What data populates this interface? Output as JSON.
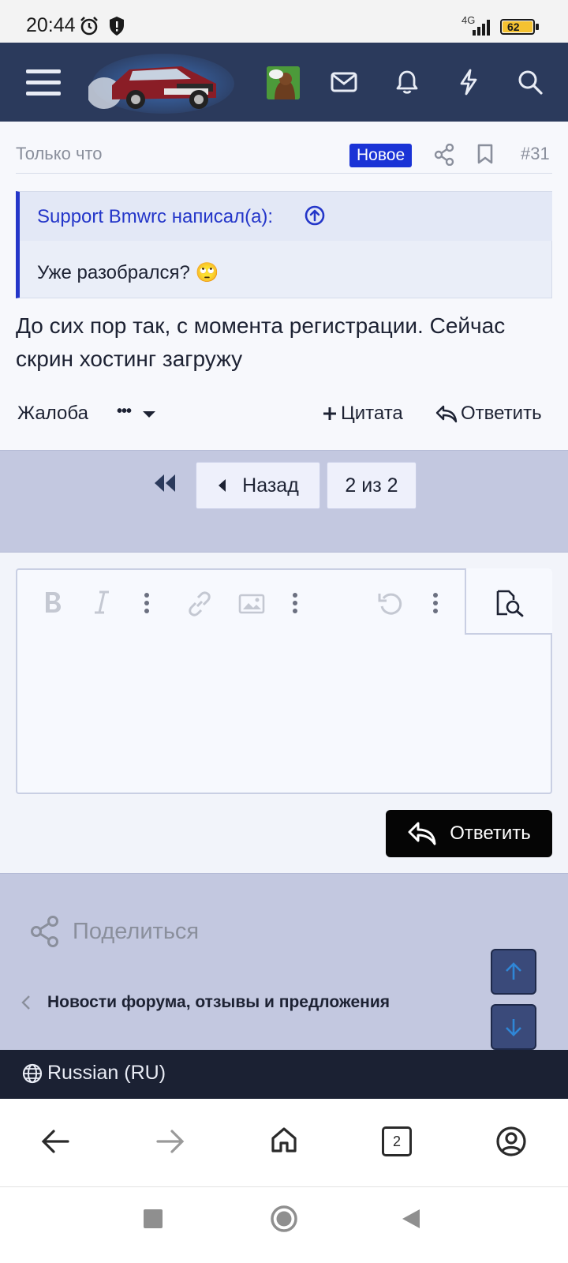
{
  "status": {
    "time": "20:44",
    "network": "4G",
    "battery": "62"
  },
  "post": {
    "time": "Только что",
    "badge": "Новое",
    "number": "#31",
    "quote_author": "Support Bmwrc написал(а):",
    "quote_text": "Уже разобрался? 🙄",
    "body": "До сих пор так, с момента регистрации. Сейчас скрин хостинг загружу",
    "report": "Жалоба",
    "more": "•••",
    "quote_action": "Цитата",
    "reply_action": "Ответить"
  },
  "pagination": {
    "back": "Назад",
    "current": "2 из 2"
  },
  "editor": {
    "reply_button": "Ответить"
  },
  "footer": {
    "share": "Поделиться",
    "breadcrumb": "Новости форума, отзывы и предложения",
    "language": "Russian (RU)"
  },
  "browser": {
    "tab_count": "2"
  },
  "colors": {
    "nav_bg": "#2b3a5c",
    "accent": "#2436c9",
    "badge": "#1a33d6",
    "band": "#c3c8e0",
    "footer_dark": "#1b2133"
  }
}
